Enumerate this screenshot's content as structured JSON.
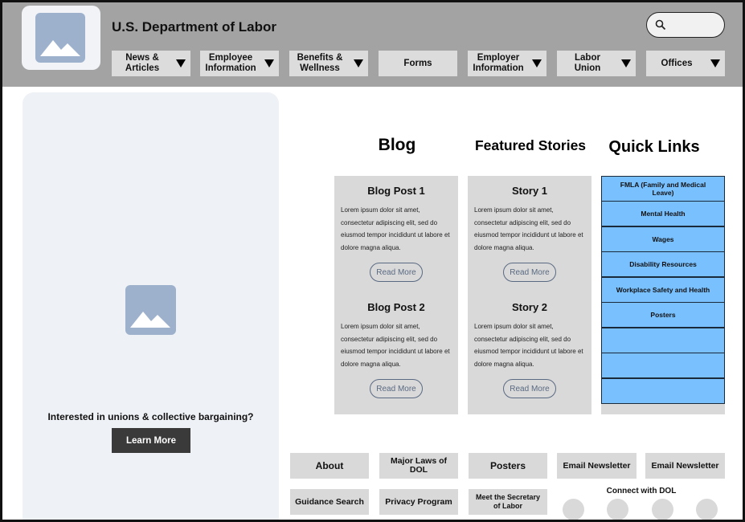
{
  "header": {
    "title": "U.S. Department of Labor",
    "logo_icon": "image-placeholder-icon",
    "search": {
      "placeholder": "",
      "icon": "search-icon"
    },
    "nav": [
      {
        "label": "News &\nArticles",
        "dropdown": true
      },
      {
        "label": "Employee\nInformation",
        "dropdown": true
      },
      {
        "label": "Benefits &\nWellness",
        "dropdown": true
      },
      {
        "label": "Forms",
        "dropdown": false
      },
      {
        "label": "Employer\nInformation",
        "dropdown": true
      },
      {
        "label": "Labor\nUnion",
        "dropdown": true
      },
      {
        "label": "Offices",
        "dropdown": true
      }
    ]
  },
  "left_panel": {
    "image_icon": "image-placeholder-icon",
    "text": "Interested in unions & collective bargaining?",
    "button_label": "Learn More"
  },
  "blog": {
    "heading": "Blog",
    "posts": [
      {
        "title": "Blog Post 1",
        "body": "Lorem ipsum dolor sit amet, consectetur adipiscing elit, sed do eiusmod tempor incididunt ut labore et dolore magna aliqua.",
        "button": "Read More"
      },
      {
        "title": "Blog Post 2",
        "body": "Lorem ipsum dolor sit amet, consectetur adipiscing elit, sed do eiusmod tempor incididunt ut labore et dolore magna aliqua.",
        "button": "Read More"
      }
    ]
  },
  "featured": {
    "heading": "Featured Stories",
    "posts": [
      {
        "title": "Story 1",
        "body": "Lorem ipsum dolor sit amet, consectetur adipiscing elit, sed do eiusmod tempor incididunt ut labore et dolore magna aliqua.",
        "button": "Read More"
      },
      {
        "title": "Story 2",
        "body": "Lorem ipsum dolor sit amet, consectetur adipiscing elit, sed do eiusmod tempor incididunt ut labore et dolore magna aliqua.",
        "button": "Read More"
      }
    ]
  },
  "quick_links": {
    "heading": "Quick Links",
    "items": [
      "FMLA (Family and Medical Leave)",
      "Mental Health",
      "Wages",
      "Disability Resources",
      "Workplace Safety and Health",
      "Posters",
      "",
      "",
      ""
    ]
  },
  "footer": {
    "row1": [
      "About",
      "Major Laws of DOL",
      "Posters",
      "Email Newsletter",
      "Email Newsletter"
    ],
    "row2": [
      "Guidance Search",
      "Privacy Program",
      "Meet the Secretary of Labor"
    ],
    "connect_label": "Connect with DOL"
  },
  "colors": {
    "header_bg": "#a3a3a3",
    "nav_bg": "#dcdcdc",
    "panel_bg": "#eef1f5",
    "image_placeholder": "#9db1cc",
    "quick_link_bg": "#79c0ff",
    "card_bg": "#d9d9d9",
    "button_dark": "#3a3a3a"
  }
}
